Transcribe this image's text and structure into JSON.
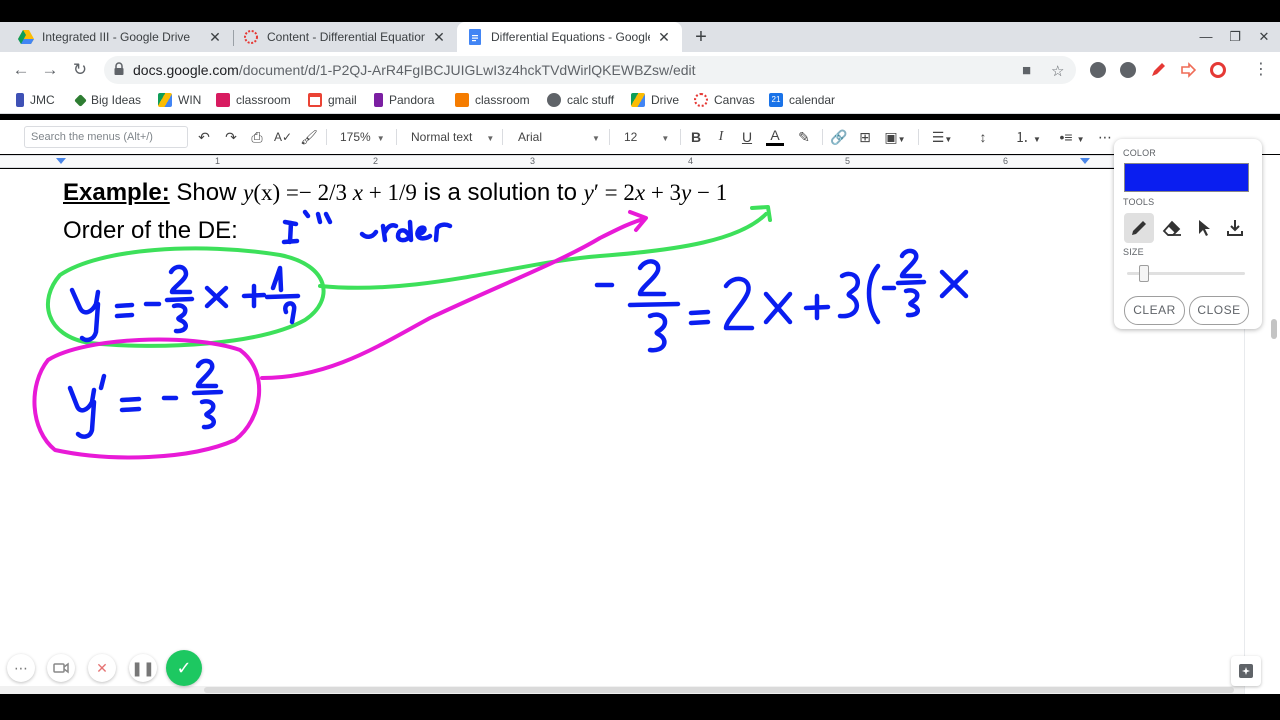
{
  "browser": {
    "tabs": [
      {
        "title": "Integrated III - Google Drive",
        "active": false
      },
      {
        "title": "Content - Differential Equations",
        "active": false
      },
      {
        "title": "Differential Equations - Google D",
        "active": true
      }
    ],
    "close_glyph": "✕",
    "new_tab_glyph": "+",
    "address": {
      "host": "docs.google.com",
      "path": "/document/d/1-P2QJ-ArR4FgIBCJUIGLwI3z4hckTVdWirlQKEWBZsw/edit"
    },
    "bookmarks": [
      {
        "label": "JMC",
        "icon": "bookmark-icon",
        "color": "#3f51b5"
      },
      {
        "label": "Big Ideas",
        "icon": "leaf-icon",
        "color": "#2e7d32"
      },
      {
        "label": "WIN",
        "icon": "drive-icon",
        "color": "#fbbc04"
      },
      {
        "label": "classroom",
        "icon": "classroom-icon",
        "color": "#d81b60"
      },
      {
        "label": "gmail",
        "icon": "gmail-icon",
        "color": "#ea4335"
      },
      {
        "label": "Pandora",
        "icon": "pandora-icon",
        "color": "#7b1fa2"
      },
      {
        "label": "classroom",
        "icon": "classroom-icon",
        "color": "#f57c00"
      },
      {
        "label": "calc stuff",
        "icon": "globe-icon",
        "color": "#5f6368"
      },
      {
        "label": "Drive",
        "icon": "drive-icon",
        "color": "#1e8e3e"
      },
      {
        "label": "Canvas",
        "icon": "canvas-icon",
        "color": "#e53935"
      },
      {
        "label": "calendar",
        "icon": "calendar-icon",
        "color": "#1a73e8"
      }
    ]
  },
  "docs_toolbar": {
    "menu_search_placeholder": "Search the menus (Alt+/)",
    "zoom": "175%",
    "style": "Normal text",
    "font": "Arial",
    "font_size": "12",
    "bold": "B",
    "italic": "I",
    "underline": "U",
    "text_color": "A"
  },
  "ruler": {
    "numbers": [
      "1",
      "2",
      "3",
      "4",
      "5",
      "6"
    ]
  },
  "document": {
    "example_label": "Example:",
    "show_word": "Show",
    "lhs_y": "y",
    "lhs_arg": "(x)",
    "lhs_rest": " =− 2/3 ",
    "lhs_x": "x",
    "lhs_tail": " + 1/9",
    "solution_text": "is a solution to",
    "de_y": "y",
    "de_rest": "′ = 2",
    "de_x": "x",
    "de_mid": " + 3",
    "de_y2": "y",
    "de_end": " − 1",
    "order_text": "Order of the DE:"
  },
  "drawing_palette": {
    "color_label": "COLOR",
    "selected_color": "#0a1ef0",
    "tools_label": "TOOLS",
    "tools": [
      "pen-icon",
      "eraser-icon",
      "pointer-icon",
      "download-icon"
    ],
    "size_label": "SIZE",
    "size_level": 0.15,
    "clear_label": "CLEAR",
    "close_label": "CLOSE"
  },
  "recorder": {
    "buttons": [
      "more-icon",
      "camera-icon",
      "cancel-icon",
      "pause-icon",
      "done-icon"
    ]
  },
  "colors": {
    "ink_blue": "#0a1ef0",
    "ink_green": "#3de05a",
    "ink_magenta": "#e81ad7"
  }
}
